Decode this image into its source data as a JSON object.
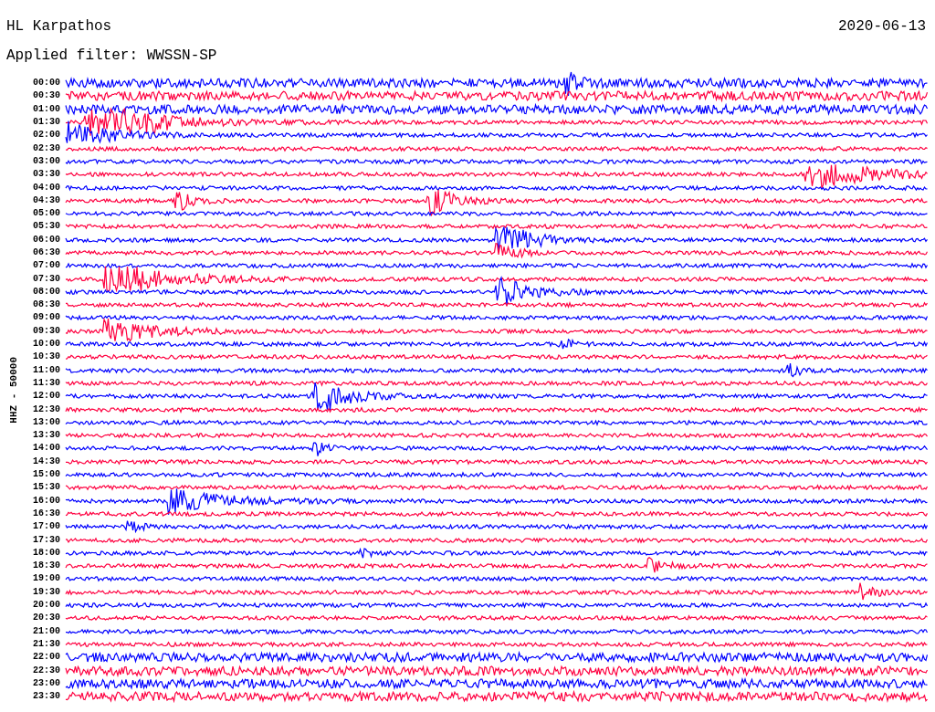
{
  "station": "HL Karpathos",
  "date": "2020-06-13",
  "filter_label": "Applied filter: WWSSN-SP",
  "channel_label": "HHZ - 50000",
  "rows": [
    {
      "time": "00:00",
      "color": "#0000ff"
    },
    {
      "time": "00:30",
      "color": "#ff0040"
    },
    {
      "time": "01:00",
      "color": "#0000ff"
    },
    {
      "time": "01:30",
      "color": "#ff0040"
    },
    {
      "time": "02:00",
      "color": "#0000ff"
    },
    {
      "time": "02:30",
      "color": "#ff0040"
    },
    {
      "time": "03:00",
      "color": "#0000ff"
    },
    {
      "time": "03:30",
      "color": "#ff0040"
    },
    {
      "time": "04:00",
      "color": "#0000ff"
    },
    {
      "time": "04:30",
      "color": "#ff0040"
    },
    {
      "time": "05:00",
      "color": "#0000ff"
    },
    {
      "time": "05:30",
      "color": "#ff0040"
    },
    {
      "time": "06:00",
      "color": "#0000ff"
    },
    {
      "time": "06:30",
      "color": "#ff0040"
    },
    {
      "time": "07:00",
      "color": "#0000ff"
    },
    {
      "time": "07:30",
      "color": "#ff0040"
    },
    {
      "time": "08:00",
      "color": "#0000ff"
    },
    {
      "time": "08:30",
      "color": "#ff0040"
    },
    {
      "time": "09:00",
      "color": "#0000ff"
    },
    {
      "time": "09:30",
      "color": "#ff0040"
    },
    {
      "time": "10:00",
      "color": "#0000ff"
    },
    {
      "time": "10:30",
      "color": "#ff0040"
    },
    {
      "time": "11:00",
      "color": "#0000ff"
    },
    {
      "time": "11:30",
      "color": "#ff0040"
    },
    {
      "time": "12:00",
      "color": "#0000ff"
    },
    {
      "time": "12:30",
      "color": "#ff0040"
    },
    {
      "time": "13:00",
      "color": "#0000ff"
    },
    {
      "time": "13:30",
      "color": "#ff0040"
    },
    {
      "time": "14:00",
      "color": "#0000ff"
    },
    {
      "time": "14:30",
      "color": "#ff0040"
    },
    {
      "time": "15:00",
      "color": "#0000ff"
    },
    {
      "time": "15:30",
      "color": "#ff0040"
    },
    {
      "time": "16:00",
      "color": "#0000ff"
    },
    {
      "time": "16:30",
      "color": "#ff0040"
    },
    {
      "time": "17:00",
      "color": "#0000ff"
    },
    {
      "time": "17:30",
      "color": "#ff0040"
    },
    {
      "time": "18:00",
      "color": "#0000ff"
    },
    {
      "time": "18:30",
      "color": "#ff0040"
    },
    {
      "time": "19:00",
      "color": "#0000ff"
    },
    {
      "time": "19:30",
      "color": "#ff0040"
    },
    {
      "time": "20:00",
      "color": "#0000ff"
    },
    {
      "time": "20:30",
      "color": "#ff0040"
    },
    {
      "time": "21:00",
      "color": "#0000ff"
    },
    {
      "time": "21:30",
      "color": "#ff0040"
    },
    {
      "time": "22:00",
      "color": "#0000ff"
    },
    {
      "time": "22:30",
      "color": "#ff0040"
    },
    {
      "time": "23:00",
      "color": "#0000ff"
    },
    {
      "time": "23:30",
      "color": "#ff0040"
    }
  ]
}
